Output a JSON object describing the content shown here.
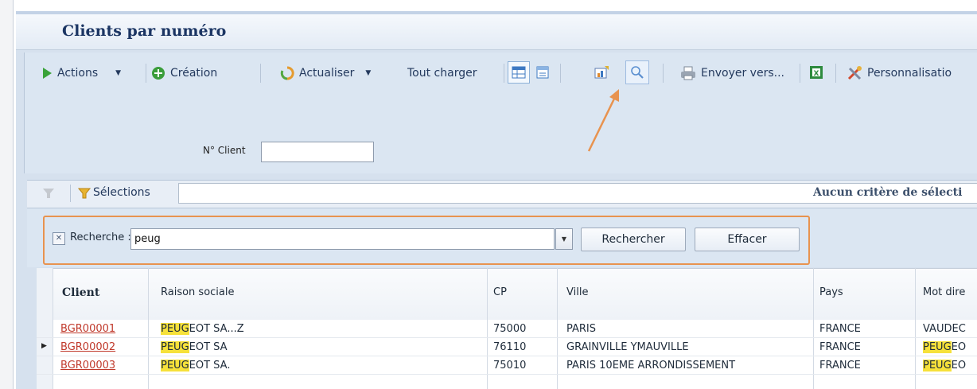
{
  "page_title": "Clients par numéro",
  "toolbar": {
    "actions": "Actions",
    "creation": "Création",
    "actualiser": "Actualiser",
    "tout_charger": "Tout charger",
    "envoyer": "Envoyer vers...",
    "personnalisation": "Personnalisatio"
  },
  "filter": {
    "client_label": "N° Client",
    "client_value": ""
  },
  "selections": {
    "label": "Sélections",
    "status": "Aucun critère de sélecti"
  },
  "search": {
    "label": "Recherche :",
    "value": "peug",
    "search_button": "Rechercher",
    "clear_button": "Effacer"
  },
  "grid": {
    "columns": [
      "Client",
      "Raison sociale",
      "CP",
      "Ville",
      "Pays",
      "Mot dire"
    ],
    "rows": [
      {
        "client": "BGR00001",
        "raison_hl": "PEUG",
        "raison_rest": "EOT SA...Z",
        "cp": "75000",
        "ville": "PARIS",
        "pays": "FRANCE",
        "mot_hl": "",
        "mot_rest": "VAUDEC"
      },
      {
        "client": "BGR00002",
        "raison_hl": "PEUG",
        "raison_rest": "EOT SA",
        "cp": "76110",
        "ville": "GRAINVILLE YMAUVILLE",
        "pays": "FRANCE",
        "mot_hl": "PEUG",
        "mot_rest": "EO"
      },
      {
        "client": "BGR00003",
        "raison_hl": "PEUG",
        "raison_rest": "EOT SA.",
        "cp": "75010",
        "ville": "PARIS 10EME ARRONDISSEMENT",
        "pays": "FRANCE",
        "mot_hl": "PEUG",
        "mot_rest": "EO"
      }
    ]
  },
  "colors": {
    "accent_orange": "#e8934f",
    "highlight": "#f6e13a",
    "link": "#c0392b",
    "title": "#1b3563"
  }
}
